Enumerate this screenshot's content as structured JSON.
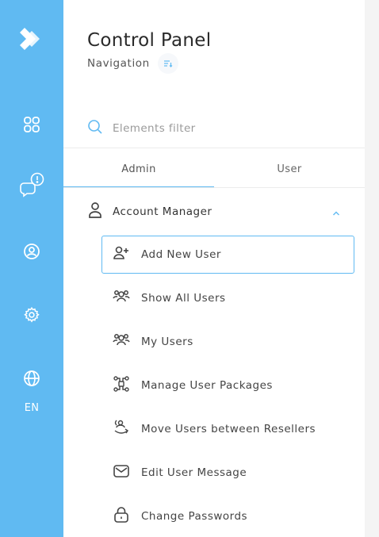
{
  "rail": {
    "logo_icon": "brand-chevron-logo",
    "items": [
      {
        "icon": "grid-icon",
        "label": "Dashboard"
      },
      {
        "icon": "chat-alert-icon",
        "label": "Notifications"
      },
      {
        "icon": "user-circle-icon",
        "label": "Account"
      },
      {
        "icon": "gear-icon",
        "label": "Settings"
      },
      {
        "icon": "globe-icon",
        "label": "Language"
      }
    ],
    "language": "EN",
    "color": "#60baf2"
  },
  "header": {
    "title": "Control Panel",
    "subtitle": "Navigation"
  },
  "search": {
    "placeholder": "Elements filter"
  },
  "tabs": [
    {
      "label": "Admin",
      "active": true
    },
    {
      "label": "User",
      "active": false
    }
  ],
  "group": {
    "label": "Account Manager",
    "expanded": true,
    "items": [
      {
        "label": "Add New User",
        "icon": "user-plus-icon",
        "selected": true
      },
      {
        "label": "Show All Users",
        "icon": "users-group-icon"
      },
      {
        "label": "My Users",
        "icon": "users-group-icon"
      },
      {
        "label": "Manage User Packages",
        "icon": "packages-icon"
      },
      {
        "label": "Move Users between Resellers",
        "icon": "move-icon"
      },
      {
        "label": "Edit User Message",
        "icon": "envelope-icon"
      },
      {
        "label": "Change Passwords",
        "icon": "lock-icon"
      }
    ]
  },
  "accent_color": "#60baf2"
}
